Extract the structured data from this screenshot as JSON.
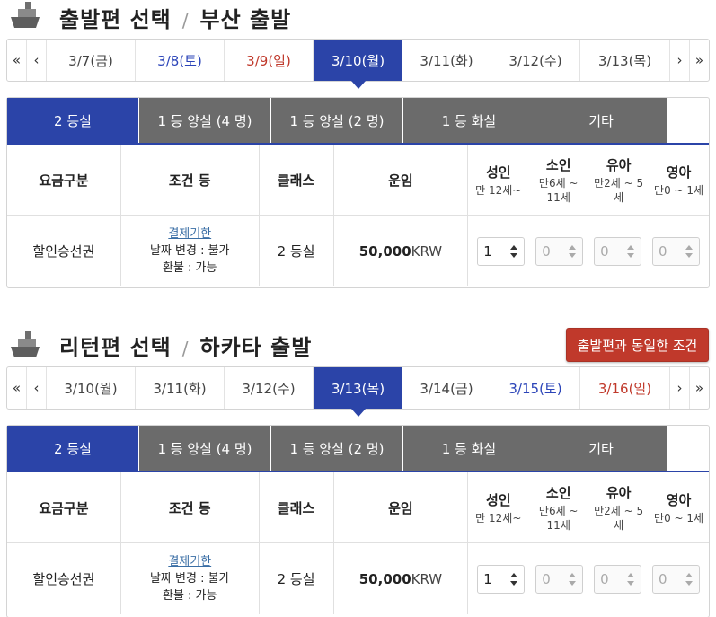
{
  "outbound": {
    "title_main": "출발편 선택",
    "title_sep": "/",
    "title_route": "부산 출발",
    "nav": {
      "first": "«",
      "prev": "‹",
      "next": "›",
      "last": "»"
    },
    "dates": [
      {
        "label": "3/7(금)",
        "kind": "normal"
      },
      {
        "label": "3/8(토)",
        "kind": "sat"
      },
      {
        "label": "3/9(일)",
        "kind": "sun"
      },
      {
        "label": "3/10(월)",
        "kind": "active"
      },
      {
        "label": "3/11(화)",
        "kind": "normal"
      },
      {
        "label": "3/12(수)",
        "kind": "normal"
      },
      {
        "label": "3/13(목)",
        "kind": "normal"
      }
    ],
    "tabs": [
      "2 등실",
      "1 등 양실 (4 명)",
      "1 등 양실 (2 명)",
      "1 등 화실",
      "기타"
    ],
    "headers": {
      "fare_type": "요금구분",
      "conditions": "조건 등",
      "class": "클래스",
      "fare": "운임",
      "adult": "성인",
      "adult_age": "만 12세~",
      "child": "소인",
      "child_age": "만6세 ~ 11세",
      "infant": "유아",
      "infant_age": "만2세 ~ 5세",
      "baby": "영아",
      "baby_age": "만0 ~ 1세"
    },
    "row": {
      "fare_type": "할인승선권",
      "deadline_link": "결제기한",
      "change": "날짜 변경 : 불가",
      "refund": "환불 : 가능",
      "class": "2 등실",
      "price": "50,000",
      "currency": "KRW",
      "adult_count": "1",
      "child_count": "0",
      "infant_count": "0",
      "baby_count": "0"
    }
  },
  "return": {
    "title_main": "리턴편 선택",
    "title_sep": "/",
    "title_route": "하카타 출발",
    "same_button": "출발편과 동일한 조건",
    "nav": {
      "first": "«",
      "prev": "‹",
      "next": "›",
      "last": "»"
    },
    "dates": [
      {
        "label": "3/10(월)",
        "kind": "normal"
      },
      {
        "label": "3/11(화)",
        "kind": "normal"
      },
      {
        "label": "3/12(수)",
        "kind": "normal"
      },
      {
        "label": "3/13(목)",
        "kind": "active"
      },
      {
        "label": "3/14(금)",
        "kind": "normal"
      },
      {
        "label": "3/15(토)",
        "kind": "sat"
      },
      {
        "label": "3/16(일)",
        "kind": "sun"
      }
    ],
    "tabs": [
      "2 등실",
      "1 등 양실 (4 명)",
      "1 등 양실 (2 명)",
      "1 등 화실",
      "기타"
    ],
    "headers": {
      "fare_type": "요금구분",
      "conditions": "조건 등",
      "class": "클래스",
      "fare": "운임",
      "adult": "성인",
      "adult_age": "만 12세~",
      "child": "소인",
      "child_age": "만6세 ~ 11세",
      "infant": "유아",
      "infant_age": "만2세 ~ 5세",
      "baby": "영아",
      "baby_age": "만0 ~ 1세"
    },
    "row": {
      "fare_type": "할인승선권",
      "deadline_link": "결제기한",
      "change": "날짜 변경 : 불가",
      "refund": "환불 : 가능",
      "class": "2 등실",
      "price": "50,000",
      "currency": "KRW",
      "adult_count": "1",
      "child_count": "0",
      "infant_count": "0",
      "baby_count": "0"
    }
  }
}
